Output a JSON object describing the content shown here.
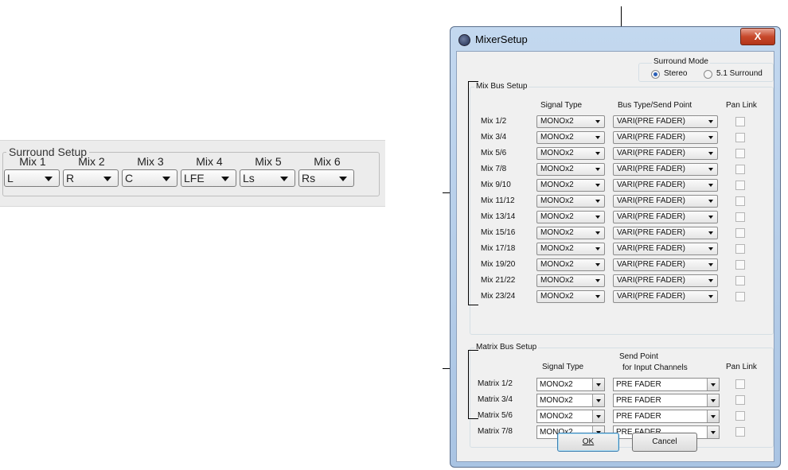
{
  "surround_setup": {
    "legend": "Surround Setup",
    "mixes": [
      {
        "label": "Mix 1",
        "value": "L"
      },
      {
        "label": "Mix 2",
        "value": "R"
      },
      {
        "label": "Mix 3",
        "value": "C"
      },
      {
        "label": "Mix 4",
        "value": "LFE"
      },
      {
        "label": "Mix 5",
        "value": "Ls"
      },
      {
        "label": "Mix 6",
        "value": "Rs"
      }
    ]
  },
  "dialog": {
    "title": "MixerSetup",
    "close_label": "X",
    "surround_mode": {
      "legend": "Surround Mode",
      "options": [
        {
          "label": "Stereo",
          "selected": true
        },
        {
          "label": "5.1 Surround",
          "selected": false
        }
      ]
    },
    "mix_bus": {
      "legend": "Mix Bus Setup",
      "col_signal": "Signal Type",
      "col_bus": "Bus Type/Send Point",
      "col_pan": "Pan Link",
      "rows": [
        {
          "name": "Mix 1/2",
          "signal": "MONOx2",
          "bus": "VARI(PRE FADER)",
          "pan": false
        },
        {
          "name": "Mix 3/4",
          "signal": "MONOx2",
          "bus": "VARI(PRE FADER)",
          "pan": false
        },
        {
          "name": "Mix 5/6",
          "signal": "MONOx2",
          "bus": "VARI(PRE FADER)",
          "pan": false
        },
        {
          "name": "Mix 7/8",
          "signal": "MONOx2",
          "bus": "VARI(PRE FADER)",
          "pan": false
        },
        {
          "name": "Mix 9/10",
          "signal": "MONOx2",
          "bus": "VARI(PRE FADER)",
          "pan": false
        },
        {
          "name": "Mix 11/12",
          "signal": "MONOx2",
          "bus": "VARI(PRE FADER)",
          "pan": false
        },
        {
          "name": "Mix 13/14",
          "signal": "MONOx2",
          "bus": "VARI(PRE FADER)",
          "pan": false
        },
        {
          "name": "Mix 15/16",
          "signal": "MONOx2",
          "bus": "VARI(PRE FADER)",
          "pan": false
        },
        {
          "name": "Mix 17/18",
          "signal": "MONOx2",
          "bus": "VARI(PRE FADER)",
          "pan": false
        },
        {
          "name": "Mix 19/20",
          "signal": "MONOx2",
          "bus": "VARI(PRE FADER)",
          "pan": false
        },
        {
          "name": "Mix 21/22",
          "signal": "MONOx2",
          "bus": "VARI(PRE FADER)",
          "pan": false
        },
        {
          "name": "Mix 23/24",
          "signal": "MONOx2",
          "bus": "VARI(PRE FADER)",
          "pan": false
        }
      ]
    },
    "matrix_bus": {
      "legend": "Matrix Bus Setup",
      "col_signal": "Signal Type",
      "col_send_1": "Send Point",
      "col_send_2": "for Input Channels",
      "col_pan": "Pan Link",
      "rows": [
        {
          "name": "Matrix 1/2",
          "signal": "MONOx2",
          "send": "PRE FADER",
          "pan": false
        },
        {
          "name": "Matrix 3/4",
          "signal": "MONOx2",
          "send": "PRE FADER",
          "pan": false
        },
        {
          "name": "Matrix 5/6",
          "signal": "MONOx2",
          "send": "PRE FADER",
          "pan": false
        },
        {
          "name": "Matrix 7/8",
          "signal": "MONOx2",
          "send": "PRE FADER",
          "pan": false
        }
      ]
    },
    "ok_label": "OK",
    "cancel_label": "Cancel"
  }
}
